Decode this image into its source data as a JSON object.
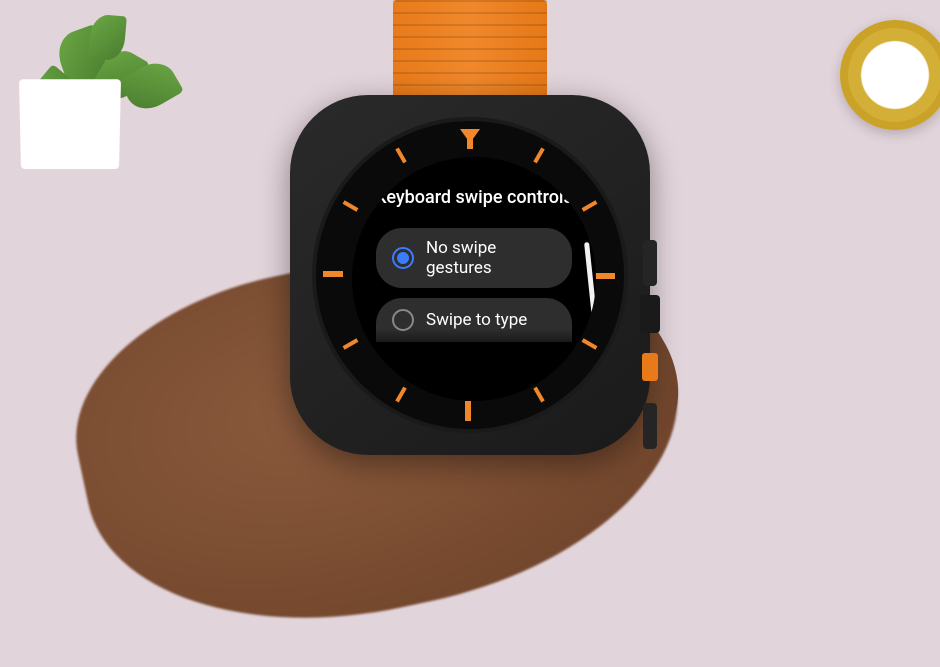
{
  "screen": {
    "title": "Keyboard swipe controls",
    "options": [
      {
        "label": "No swipe gestures",
        "selected": true
      },
      {
        "label": "Swipe to type",
        "selected": false
      }
    ]
  }
}
